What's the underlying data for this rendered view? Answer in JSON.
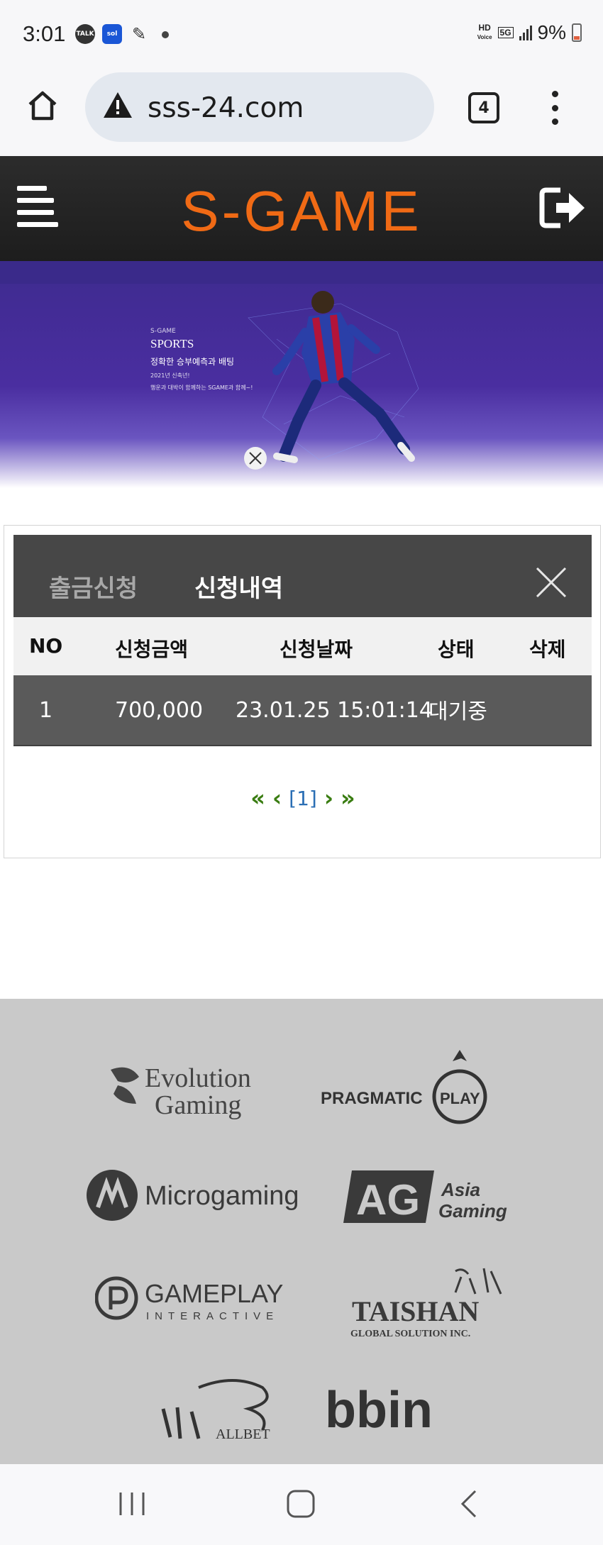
{
  "status_bar": {
    "time": "3:01",
    "notification_icons": [
      "talk-icon",
      "sol-icon",
      "pen-icon",
      "dot-icon"
    ],
    "talk_label": "TALK",
    "sol_label": "sol",
    "hd_label": "HD",
    "voice_label": "Voice",
    "network_label": "5G",
    "battery_percent": "9%"
  },
  "browser": {
    "url": "sss-24.com",
    "tab_count": "4",
    "security_state": "not-secure-warning"
  },
  "site": {
    "logo_text": "S-GAME",
    "brand_color": "#f06a15"
  },
  "banner": {
    "brand_small": "S-GAME",
    "title": "SPORTS",
    "subtitle": "정확한 승부예측과 배팅",
    "line1": "2021년 신축년!",
    "line2": "행운과 대박이 함께하는 SGAME과 함께~!"
  },
  "panel": {
    "tabs": [
      {
        "label": "출금신청",
        "active": false
      },
      {
        "label": "신청내역",
        "active": true
      }
    ],
    "columns": [
      "NO",
      "신청금액",
      "신청날짜",
      "상태",
      "삭제"
    ],
    "rows": [
      {
        "no": "1",
        "amount": "700,000",
        "date": "23.01.25 15:01:14",
        "status": "대기중",
        "delete": ""
      }
    ],
    "pagination": {
      "first": "«",
      "prev": "‹",
      "current": "[1]",
      "next": "›",
      "last": "»"
    }
  },
  "partners": [
    "Evolution Gaming",
    "PRAGMATIC PLAY",
    "Microgaming",
    "AG Asia Gaming",
    "GAMEPLAY INTERACTIVE",
    "TAISHAN GLOBAL SOLUTION INC.",
    "ALLBET",
    "bbin"
  ],
  "partner_text": {
    "evo_1": "Evolution",
    "evo_2": "Gaming",
    "prag_1": "PRAGMATIC",
    "prag_2": "PLAY",
    "micro": "Microgaming",
    "ag_1": "AG",
    "ag_2": "Asia",
    "ag_3": "Gaming",
    "gp_1": "GAMEPLAY",
    "gp_2": "INTERACTIVE",
    "ts_1": "TAISHAN",
    "ts_2": "GLOBAL SOLUTION INC.",
    "allbet": "ALLBET",
    "bbin": "bbin"
  },
  "colors": {
    "header_bg": "#1f1f1f",
    "banner_bg": "#4a2ea0",
    "table_head_bg": "#474747",
    "table_row_bg": "#5a5a5a",
    "pager_green": "#3a7d12",
    "pager_blue": "#2a6eb4",
    "partners_bg": "#c9c9c9"
  }
}
